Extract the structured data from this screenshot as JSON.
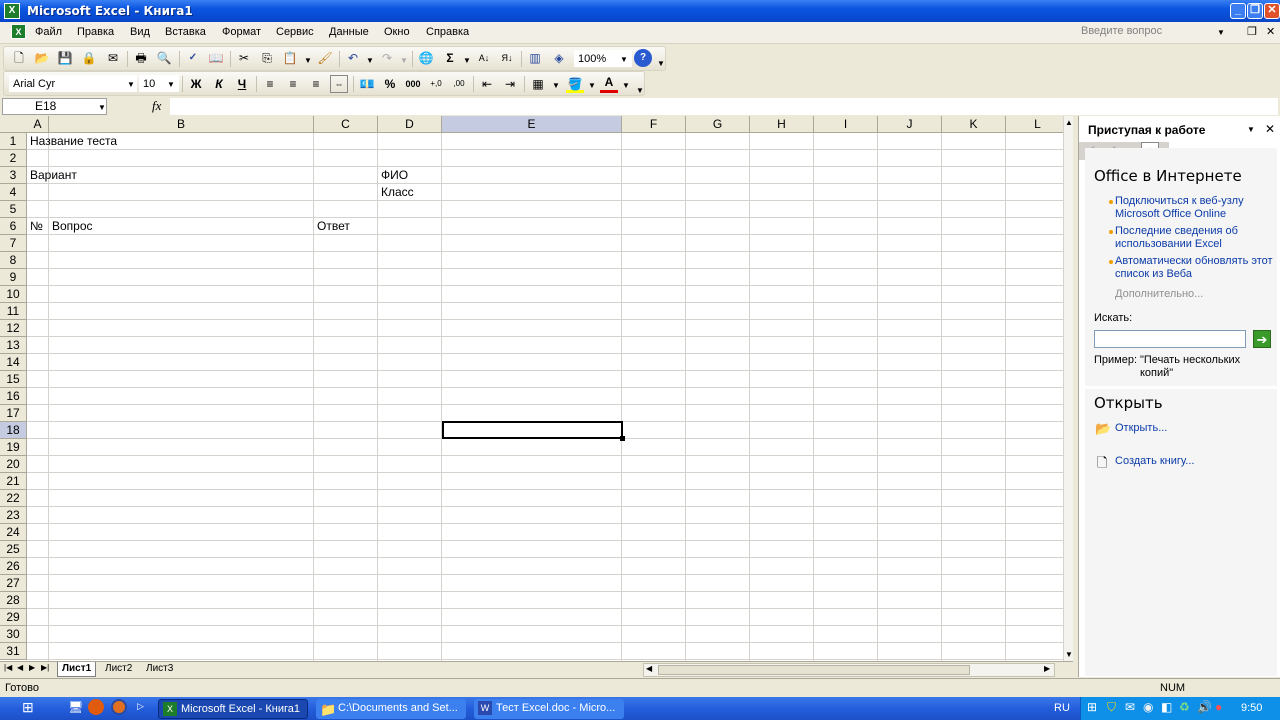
{
  "window": {
    "title": "Microsoft Excel - Книга1"
  },
  "menu": {
    "items": [
      "Файл",
      "Правка",
      "Вид",
      "Вставка",
      "Формат",
      "Сервис",
      "Данные",
      "Окно",
      "Справка"
    ],
    "help_placeholder": "Введите вопрос"
  },
  "toolbar": {
    "zoom": "100%",
    "font": "Arial Cyr",
    "size": "10",
    "bold": "Ж",
    "italic": "К",
    "underline": "Ч",
    "percent": "%",
    "thousands": "000"
  },
  "formula": {
    "namebox": "E18",
    "fx": "fx"
  },
  "grid": {
    "columns": [
      "A",
      "B",
      "C",
      "D",
      "E",
      "F",
      "G",
      "H",
      "I",
      "J",
      "K",
      "L"
    ],
    "selected_column": "E",
    "selected_row": "18",
    "rows": [
      "1",
      "2",
      "3",
      "4",
      "5",
      "6",
      "7",
      "8",
      "9",
      "10",
      "11",
      "12",
      "13",
      "14",
      "15",
      "16",
      "17",
      "18",
      "19",
      "20",
      "21",
      "22",
      "23",
      "24",
      "25",
      "26",
      "27",
      "28",
      "29",
      "30",
      "31"
    ],
    "cells": {
      "A1": "Название теста",
      "A3": "Вариант",
      "D3": "ФИО",
      "D4": "Класс",
      "A6": "№",
      "B6": "Вопрос",
      "C6": "Ответ"
    }
  },
  "sheets": [
    "Лист1",
    "Лист2",
    "Лист3"
  ],
  "taskpane": {
    "title": "Приступая к работе",
    "section1": "Office в Интернете",
    "link1": "Подключиться к веб-узлу Microsoft Office Online",
    "link2": "Последние сведения об использовании Excel",
    "link3": "Автоматически обновлять этот список из Веба",
    "more": "Дополнительно...",
    "search_label": "Искать:",
    "example_label": "Пример:",
    "example_text": "\"Печать нескольких копий\"",
    "section2": "Открыть",
    "open_link": "Открыть...",
    "create_link": "Создать книгу..."
  },
  "status": {
    "left": "Готово",
    "num": "NUM"
  },
  "taskbar": {
    "tasks": [
      "Microsoft Excel - Книга1",
      "C:\\Documents and Set...",
      "Тест Excel.doc - Micro..."
    ],
    "lang": "RU",
    "time": "9:50"
  }
}
